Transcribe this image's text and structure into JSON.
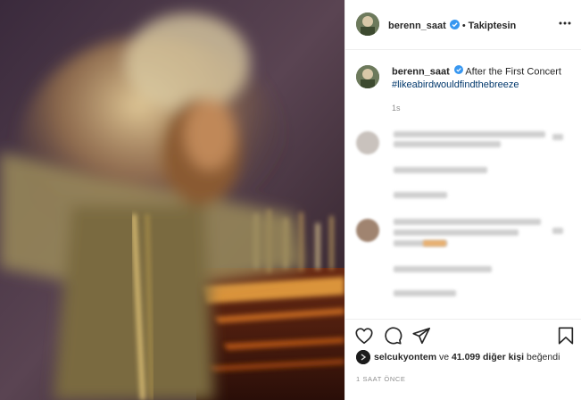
{
  "post": {
    "author": {
      "username": "berenn_saat",
      "verified": true,
      "follow_state": "Takiptesin",
      "separator": "•"
    },
    "caption": {
      "text": "After the First Concert",
      "hashtag": "#likeabirdwouldfindthebreeze",
      "time": "1s"
    },
    "likes": {
      "liker": "selcukyontem",
      "connector": "ve",
      "count": "41.099 diğer kişi",
      "suffix": "beğendi"
    },
    "time_ago": "1 SAAT ÖNCE"
  },
  "icons": {
    "more": "more-horizontal-icon",
    "like": "heart-icon",
    "comment": "comment-icon",
    "share": "send-icon",
    "save": "bookmark-icon",
    "verified": "verified-badge-icon"
  },
  "colors": {
    "verified": "#3897f0",
    "hashtag": "#00376b",
    "muted": "#8e8e8e",
    "text": "#262626"
  }
}
